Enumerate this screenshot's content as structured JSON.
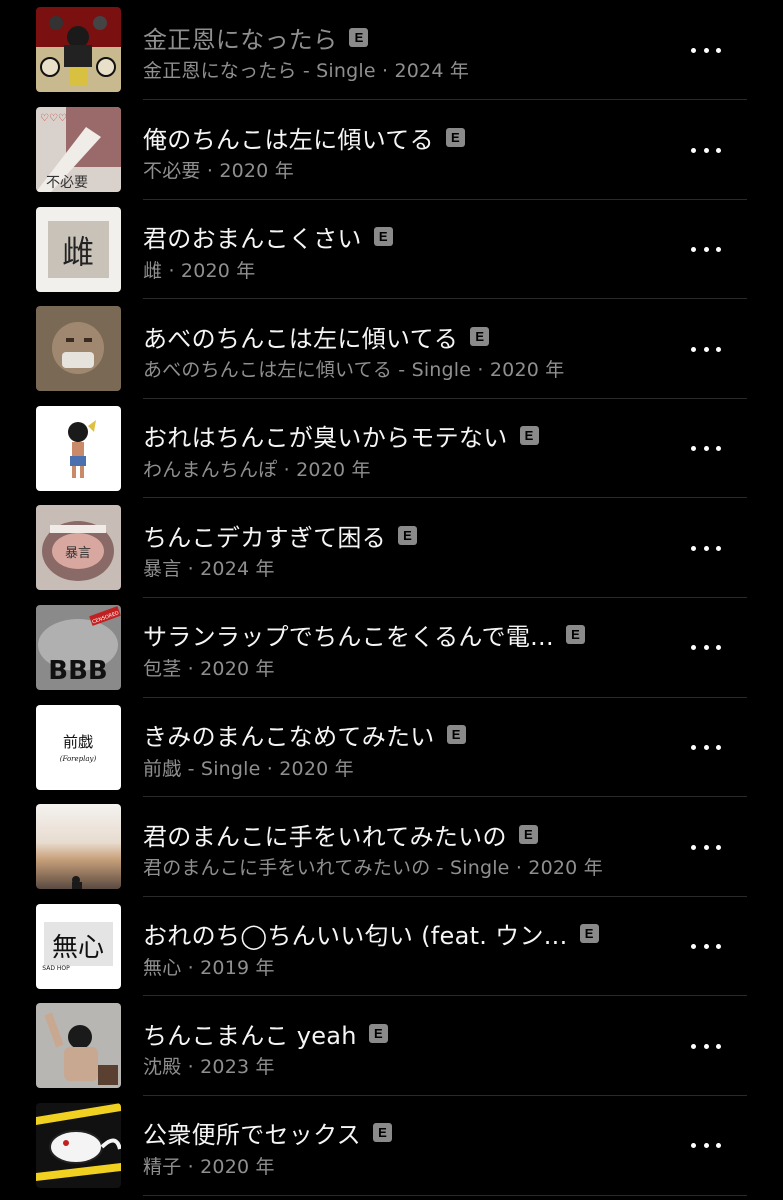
{
  "explicit_badge": "E",
  "songs": [
    {
      "title": "金正恩になったら",
      "subtitle": "金正恩になったら - Single · 2024 年",
      "explicit": true,
      "dim": true,
      "art": "kim-jong-un-art"
    },
    {
      "title": "俺のちんこは左に傾いてる",
      "subtitle": "不必要 · 2020 年",
      "explicit": true,
      "art": "fuhitsuyou-art"
    },
    {
      "title": "君のおまんこくさい",
      "subtitle": "雌 · 2020 年",
      "explicit": true,
      "art": "mesu-art"
    },
    {
      "title": "あべのちんこは左に傾いてる",
      "subtitle": "あべのちんこは左に傾いてる - Single · 2020 年",
      "explicit": true,
      "art": "abe-art"
    },
    {
      "title": "おれはちんこが臭いからモテない",
      "subtitle": "わんまんちんぽ · 2020 年",
      "explicit": true,
      "art": "wanman-art"
    },
    {
      "title": "ちんこデカすぎて困る",
      "subtitle": "暴言 · 2024 年",
      "explicit": true,
      "art": "bougen-art"
    },
    {
      "title": "サランラップでちんこをくるんで電...",
      "subtitle": "包茎 · 2020 年",
      "explicit": true,
      "art": "houkei-art"
    },
    {
      "title": "きみのまんこなめてみたい",
      "subtitle": "前戯 - Single · 2020 年",
      "explicit": true,
      "art": "zengi-art"
    },
    {
      "title": "君のまんこに手をいれてみたいの",
      "subtitle": "君のまんこに手をいれてみたいの - Single · 2020 年",
      "explicit": true,
      "art": "sunset-art"
    },
    {
      "title": "おれのち◯ちんいい匂い (feat. ウン...",
      "subtitle": "無心 · 2019 年",
      "explicit": true,
      "art": "mushin-art"
    },
    {
      "title": "ちんこまんこ yeah",
      "subtitle": "沈殿 · 2023 年",
      "explicit": true,
      "art": "chinden-art"
    },
    {
      "title": "公衆便所でセックス",
      "subtitle": "精子 · 2020 年",
      "explicit": true,
      "art": "seishi-art"
    }
  ],
  "art_text": {
    "fuhitsuyou": "不必要",
    "mesu": "雌",
    "bougen": "暴言",
    "houkei": "BBB",
    "houkei_tag": "CENSORED",
    "zengi": "前戯",
    "zengi_sub": "(Foreplay)",
    "mushin": "無心",
    "mushin_sub": "SAD HOP"
  },
  "colors": {
    "background": "#000000",
    "title": "#f5f5f5",
    "subtitle": "#8f8f8f",
    "badge": "#8a8a8a",
    "divider": "#2a2a2a"
  }
}
